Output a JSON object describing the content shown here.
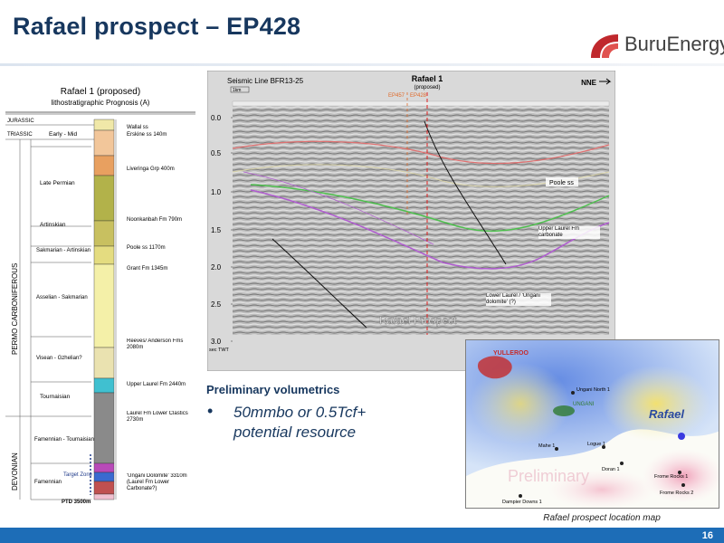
{
  "title": "Rafael prospect – EP428",
  "logo": {
    "text": "BuruEnergy"
  },
  "strat": {
    "title": "Rafael 1 (proposed)",
    "subtitle": "lithostratigraphic Prognosis (A)",
    "periods": {
      "jurassic": "JURASSIC",
      "triassic": "TRIASSIC",
      "permo": "PERMO CARBONIFEROUS",
      "devonian": "DEVONIAN"
    },
    "stages": [
      "Early - Mid",
      "Late Permian",
      "Artinskian",
      "Sakmarian - Artinskian",
      "Asselian - Sakmarian",
      "Visean - Gzhelian?",
      "Tournaisian",
      "Famennian - Tournaisian",
      "Famennian"
    ],
    "formations": [
      "Wallal ss",
      "Erskine ss 140m",
      "Liveringa Grp 400m",
      "Noonkanbah Fm 790m",
      "Poole ss 1170m",
      "Grant Fm 1345m",
      "Reeves/ Anderson Fms 2080m",
      "Upper Laurel Fm 2440m",
      "Laurel Fm Lower Clastics 2730m",
      "'Ungani Dolomite' 3310m (Laurel Fm Lower Carbonate?)"
    ],
    "target_zone": "Target Zone",
    "ptd": "PTD 3500m"
  },
  "seismic": {
    "line_label": "Seismic Line BFR13-25",
    "well_name": "Rafael 1",
    "well_status": "(proposed)",
    "direction": "NNE",
    "scale": "1km",
    "permit_left": "EP457",
    "permit_right": "EP428",
    "axis_unit": "sec TWT",
    "y_ticks": [
      "0.0",
      "0.5",
      "1.0",
      "1.5",
      "2.0",
      "2.5",
      "3.0"
    ],
    "annotations": {
      "poole": "Poole ss",
      "upper_laurel": "Upper Laurel Fm carbonate",
      "lower_laurel": "Lower Laurel / 'Ungani dolomite' (?)",
      "prospect": "Rafael Prospect"
    }
  },
  "volumetrics": {
    "heading": "Preliminary  volumetrics",
    "bullet": "•",
    "item": "50mmbo or 0.5Tcf+ potential resource"
  },
  "map": {
    "labels": {
      "yulleroo": "YULLEROO",
      "ungani_north": "Ungani North 1",
      "ungani": "UNGANI",
      "rafael": "Rafael",
      "mahe": "Mahe 1",
      "logue": "Logue 1",
      "doran": "Doran 1",
      "frome1": "Frome Rocks 1",
      "frome2": "Frome Rocks 2",
      "dampier": "Dampier Downs 1",
      "watermark": "Preliminary"
    },
    "caption": "Rafael prospect location map"
  },
  "page_number": "16"
}
